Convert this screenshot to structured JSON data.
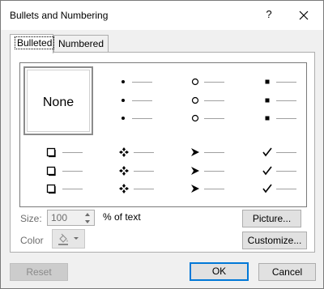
{
  "title": "Bullets and Numbering",
  "titlebar": {
    "help": "?",
    "close_icon": "close-icon"
  },
  "tabs": [
    {
      "label": "Bulleted",
      "active": true
    },
    {
      "label": "Numbered",
      "active": false
    }
  ],
  "gallery": {
    "none_label": "None",
    "bullet_styles": [
      "filled-dot",
      "hollow-circle",
      "filled-square",
      "hollow-square",
      "four-diamond",
      "arrowhead",
      "checkmark"
    ]
  },
  "size": {
    "label": "Size:",
    "value": "100",
    "unit": "% of text"
  },
  "color": {
    "label": "Color"
  },
  "buttons": {
    "picture": "Picture...",
    "customize": "Customize...",
    "reset": "Reset",
    "ok": "OK",
    "cancel": "Cancel"
  },
  "colors": {
    "accent": "#0078d7"
  }
}
